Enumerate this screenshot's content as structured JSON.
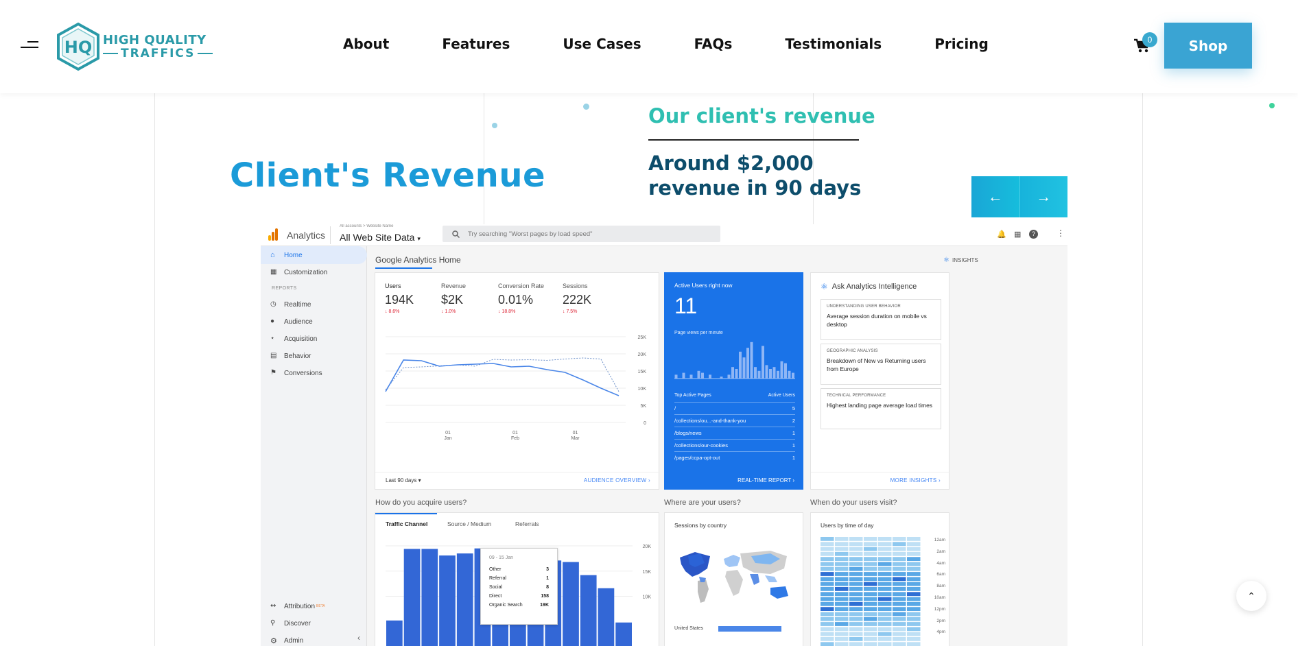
{
  "header": {
    "logo": {
      "line1": "HIGH QUALITY",
      "line2": "TRAFFICS"
    },
    "nav": [
      "About",
      "Features",
      "Use Cases",
      "FAQs",
      "Testimonials",
      "Pricing"
    ],
    "cart_count": "0",
    "shop_label": "Shop"
  },
  "hero": {
    "title": "Client's Revenue",
    "subtitle": "Our client's revenue",
    "description": "Around $2,000 revenue in 90 days"
  },
  "colors": {
    "accent": "#1b9bd8",
    "teal": "#2fbfb1",
    "navy": "#0d4d6b",
    "shop": "#3aa4d3",
    "ga_blue": "#1a73e8"
  },
  "analytics": {
    "app_name": "Analytics",
    "account_line": "All accounts > Website Name",
    "property": "All Web Site Data",
    "search_placeholder": "Try searching \"Worst pages by load speed\"",
    "sidebar": {
      "home": "Home",
      "customization": "Customization",
      "reports_label": "REPORTS",
      "reports": [
        "Realtime",
        "Audience",
        "Acquisition",
        "Behavior",
        "Conversions"
      ],
      "bottom": [
        {
          "label": "Attribution",
          "badge": "BETA"
        },
        {
          "label": "Discover"
        },
        {
          "label": "Admin"
        }
      ]
    },
    "home_title": "Google Analytics Home",
    "insights_label": "INSIGHTS",
    "kpis": [
      {
        "label": "Users",
        "value": "194K",
        "delta": "8.6%"
      },
      {
        "label": "Revenue",
        "value": "$2K",
        "delta": "1.0%"
      },
      {
        "label": "Conversion Rate",
        "value": "0.01%",
        "delta": "18.8%"
      },
      {
        "label": "Sessions",
        "value": "222K",
        "delta": "7.5%"
      }
    ],
    "line_chart": {
      "y_ticks": [
        "25K",
        "20K",
        "15K",
        "10K",
        "5K",
        "0"
      ],
      "x_ticks": [
        {
          "day": "01",
          "month": "Jan"
        },
        {
          "day": "01",
          "month": "Feb"
        },
        {
          "day": "01",
          "month": "Mar"
        }
      ],
      "current": [
        9,
        18.2,
        18,
        16.4,
        16.8,
        17,
        17.2,
        16.2,
        16.4,
        15.4,
        14.6,
        12.4,
        10,
        7.8
      ],
      "previous": [
        9.5,
        16,
        16.2,
        16.5,
        16.8,
        16.4,
        18.4,
        18.2,
        18.3,
        18.1,
        18.5,
        18.8,
        18.5,
        9
      ]
    },
    "date_range": "Last 90 days",
    "audience_overview": "AUDIENCE OVERVIEW",
    "realtime": {
      "title": "Active Users right now",
      "value": "11",
      "subtitle": "Page views per minute",
      "bars": [
        0.1,
        0,
        0.15,
        0,
        0.1,
        0,
        0.2,
        0.15,
        0,
        0.1,
        0,
        0,
        0.05,
        0,
        0.1,
        0.3,
        0.25,
        0.7,
        0.55,
        0.8,
        0.95,
        0.3,
        0.2,
        0.85,
        0.35,
        0.25,
        0.3,
        0.2,
        0.45,
        0.4,
        0.2,
        0.15
      ],
      "table_headers": [
        "Top Active Pages",
        "Active Users"
      ],
      "pages": [
        {
          "page": "/",
          "users": "5"
        },
        {
          "page": "/collections/ou...-and-thank-you",
          "users": "2"
        },
        {
          "page": "/blogs/news",
          "users": "1"
        },
        {
          "page": "/collections/our-cookies",
          "users": "1"
        },
        {
          "page": "/pages/ccpa-opt-out",
          "users": "1"
        }
      ],
      "link": "REAL-TIME REPORT"
    },
    "intelligence": {
      "title": "Ask Analytics Intelligence",
      "cards": [
        {
          "tag": "UNDERSTANDING USER BEHAVIOR",
          "text": "Average session duration on mobile vs desktop"
        },
        {
          "tag": "GEOGRAPHIC ANALYSIS",
          "text": "Breakdown of New vs Returning users from Europe"
        },
        {
          "tag": "TECHNICAL PERFORMANCE",
          "text": "Highest landing page average load times"
        }
      ],
      "link": "MORE INSIGHTS"
    },
    "acquire": {
      "title": "How do you acquire users?",
      "tabs": [
        "Traffic Channel",
        "Source / Medium",
        "Referrals"
      ],
      "y_ticks": [
        "20K",
        "15K",
        "10K"
      ],
      "bars": [
        5200,
        19400,
        19400,
        18100,
        18500,
        19500,
        17800,
        18800,
        17400,
        17100,
        16800,
        14200,
        11600,
        4800
      ],
      "tooltip": {
        "title": "09 - 15 Jan",
        "rows": [
          {
            "label": "Other",
            "value": "3"
          },
          {
            "label": "Referral",
            "value": "1"
          },
          {
            "label": "Social",
            "value": "8"
          },
          {
            "label": "Direct",
            "value": "158"
          },
          {
            "label": "Organic Search",
            "value": "19K"
          }
        ]
      }
    },
    "where": {
      "title": "Where are your users?",
      "subtitle": "Sessions by country",
      "country": "United States"
    },
    "when": {
      "title": "When do your users visit?",
      "subtitle": "Users by time of day",
      "hours": [
        "12am",
        "2am",
        "4am",
        "6am",
        "8am",
        "10am",
        "12pm",
        "2pm",
        "4pm"
      ]
    }
  }
}
